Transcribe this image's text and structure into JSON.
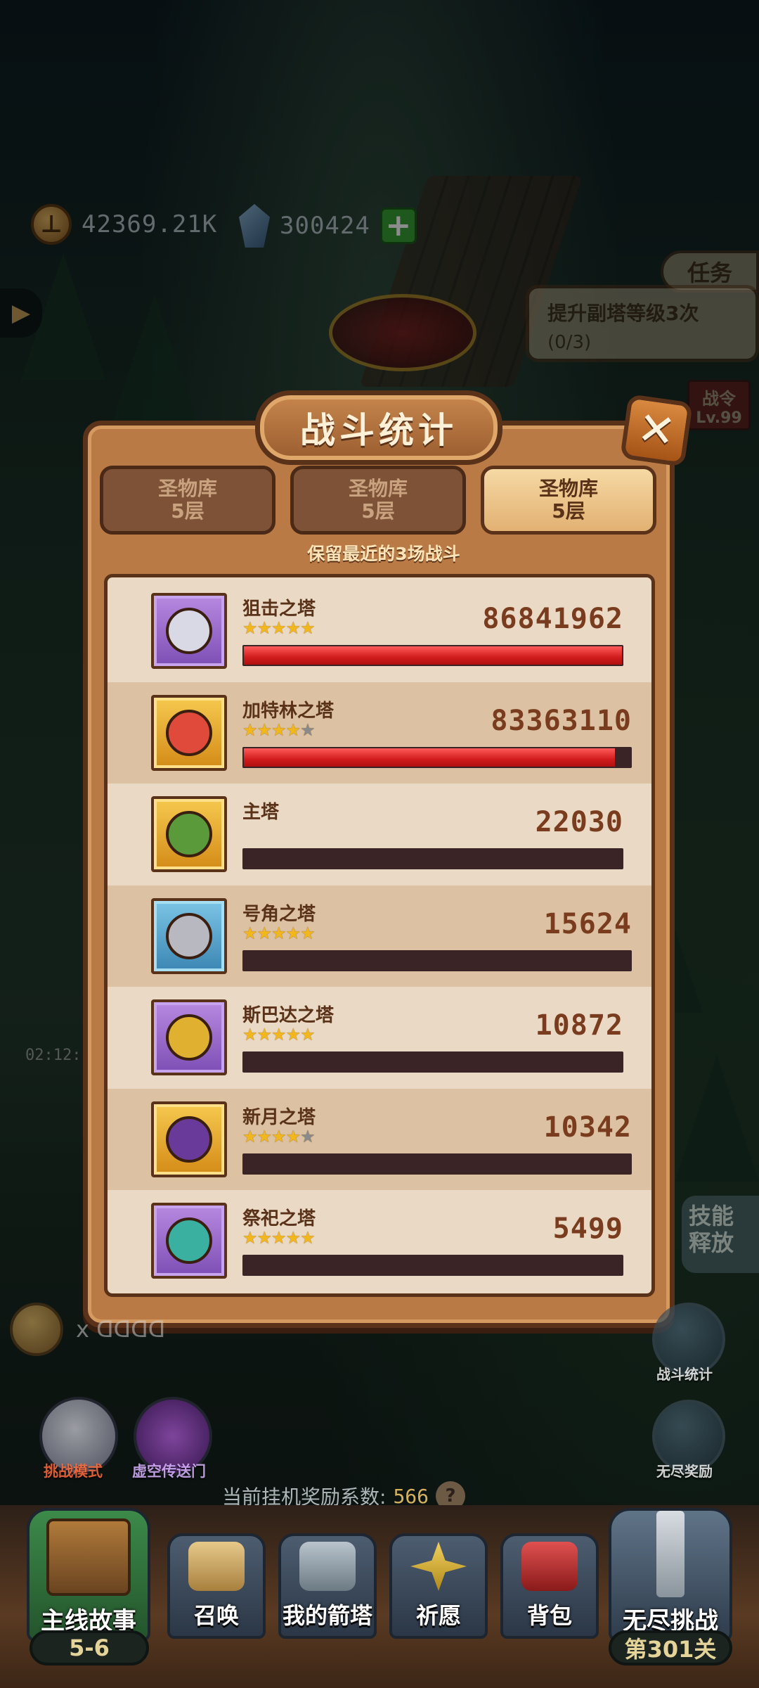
{
  "resources": {
    "coins": "42369.21K",
    "gems": "300424"
  },
  "task": {
    "tab": "任务",
    "line1": "提升副塔等级3次",
    "line2": "(0/3)"
  },
  "battle_pass": {
    "title": "战令",
    "level": "Lv.99"
  },
  "modal": {
    "title": "战斗统计",
    "close": "✕",
    "tabs": [
      {
        "line1": "圣物库",
        "line2": "5层",
        "active": false
      },
      {
        "line1": "圣物库",
        "line2": "5层",
        "active": false
      },
      {
        "line1": "圣物库",
        "line2": "5层",
        "active": true
      }
    ],
    "note": "保留最近的3场战斗",
    "rows": [
      {
        "name": "狙击之塔",
        "stars": 5,
        "damage": "86841962",
        "fraction": 1.0,
        "frame": "purple",
        "face": "#d9d9e6"
      },
      {
        "name": "加特林之塔",
        "stars": 4,
        "damage": "83363110",
        "fraction": 0.96,
        "frame": "gold",
        "face": "#e04a3a"
      },
      {
        "name": "主塔",
        "stars": 0,
        "damage": "22030",
        "fraction": 0.0,
        "frame": "gold",
        "face": "#5a9a3a"
      },
      {
        "name": "号角之塔",
        "stars": 5,
        "damage": "15624",
        "fraction": 0.0,
        "frame": "blue",
        "face": "#b8b8c0"
      },
      {
        "name": "斯巴达之塔",
        "stars": 5,
        "damage": "10872",
        "fraction": 0.0,
        "frame": "purple",
        "face": "#e0b030"
      },
      {
        "name": "新月之塔",
        "stars": 4,
        "damage": "10342",
        "fraction": 0.0,
        "frame": "gold",
        "face": "#6a3a9a"
      },
      {
        "name": "祭祀之塔",
        "stars": 5,
        "damage": "5499",
        "fraction": 0.0,
        "frame": "purple",
        "face": "#3ab0a0"
      }
    ]
  },
  "side": {
    "battle_stats": "战斗统计",
    "endless_reward": "无尽奖励",
    "skill_release_1": "技能",
    "skill_release_2": "释放"
  },
  "modes": {
    "challenge": "挑战模式",
    "portal": "虚空传送门"
  },
  "revive_count": "x ᗡᗡᗡᗡ",
  "reward_line": {
    "label": "当前挂机奖励系数:",
    "value": "566",
    "help": "?"
  },
  "nav": {
    "story": "主线故事",
    "story_stage": "5-6",
    "summon": "召唤",
    "my_towers": "我的箭塔",
    "pray": "祈愿",
    "bag": "背包",
    "endless": "无尽挑战",
    "endless_stage": "第301关"
  },
  "timer": "02:12:",
  "colors": {
    "bar_fill": "#d11c1c",
    "bar_empty": "#3a2426",
    "panel": "#b97a46",
    "list_bg": "#ead9c4"
  }
}
